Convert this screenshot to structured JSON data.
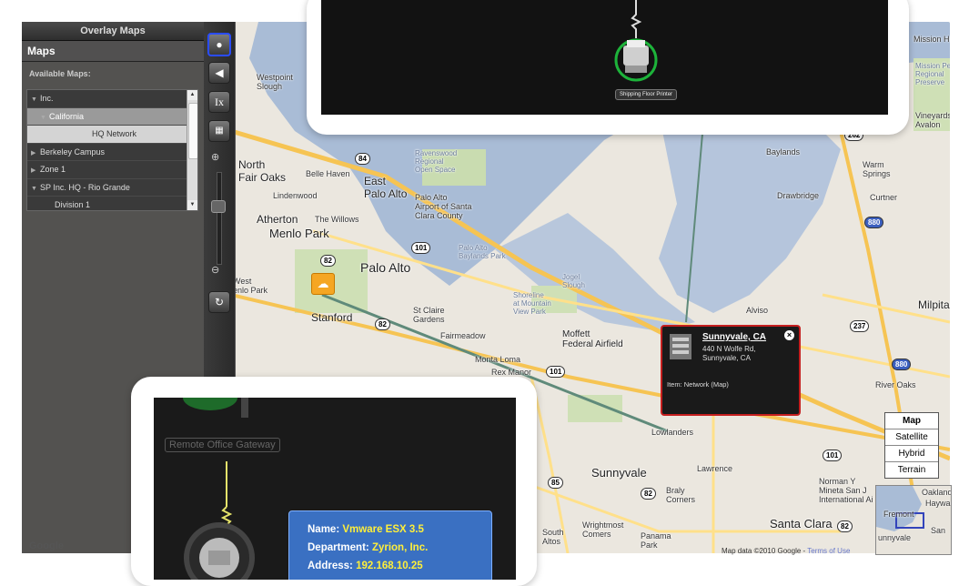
{
  "sidebar": {
    "title": "Overlay Maps",
    "heading": "Maps",
    "available_label": "Available Maps:",
    "tree": [
      {
        "label": "Inc.",
        "kind": "root"
      },
      {
        "label": "California",
        "kind": "sel"
      },
      {
        "label": "HQ Network",
        "kind": "hq"
      },
      {
        "label": "Berkeley Campus",
        "kind": "root"
      },
      {
        "label": "Zone 1",
        "kind": "root"
      },
      {
        "label": "SP Inc. HQ - Rio Grande",
        "kind": "root"
      },
      {
        "label": "Division 1",
        "kind": "child"
      }
    ]
  },
  "toolbar": {
    "buttons": [
      "pointer-icon",
      "back-icon",
      "ix-icon",
      "layout-icon",
      "zoom-in-icon",
      "zoom-out-icon",
      "refresh-icon"
    ]
  },
  "top_panel": {
    "printer_label": "Shipping Floor Printer"
  },
  "popup": {
    "title": "Sunnyvale, CA",
    "addr1": "440 N Wolfe Rd,",
    "addr2": "Sunnyvale, CA",
    "item": "Item: Network (Map)",
    "close": "×"
  },
  "bottom_panel": {
    "gateway_label": "Remote Office Gateway",
    "name_label": "Name:",
    "name_value": "Vmware ESX 3.5",
    "dept_label": "Department:",
    "dept_value": "Zyrion, Inc.",
    "addr_label": "Address:",
    "addr_value": "192.168.10.25"
  },
  "map_type": {
    "options": [
      "Map",
      "Satellite",
      "Hybrid",
      "Terrain"
    ],
    "selected": "Map"
  },
  "overview": {
    "labels": [
      "Oakland",
      "Haywa",
      "Fremont",
      "unnyvale",
      "San"
    ]
  },
  "map_footer": {
    "data": "Map data ©2010  Google -",
    "terms": "Terms of Use",
    "logo": "Google"
  },
  "map_labels": {
    "westpoint_slough": "Westpoint\nSlough",
    "north_fair_oaks": "North\nFair Oaks",
    "belle_haven": "Belle Haven",
    "east_palo_alto": "East\nPalo Alto",
    "lindenwood": "Lindenwood",
    "atherton": "Atherton",
    "the_willows": "The Willows",
    "menlo_park": "Menlo Park",
    "palo_alto": "Palo Alto",
    "west_menlo_park": "West\nenlo Park",
    "stanford": "Stanford",
    "ravenswood": "Ravenswood\nRegional\nOpen Space",
    "palo_alto_airport": "Palo Alto\nAirport of Santa\nClara County",
    "palo_alto_baylands": "Palo Alto\nBaylands Park",
    "st_claire": "St Claire\nGardens",
    "shoreline": "Shoreline\nat Mountain\nView Park",
    "jogel": "Jogel\nSlough",
    "moffett": "Moffett\nFederal Airfield",
    "fairmeadow": "Fairmeadow",
    "monta_loma": "Monta Loma",
    "rex_manor": "Rex Manor",
    "sunnyvale": "Sunnyvale",
    "lowlanders": "Lowlanders",
    "lawrence": "Lawrence",
    "santa_clara": "Santa Clara",
    "braly_corners": "Braly\nCorners",
    "wrightmost": "Wrightmost\nComers",
    "panama_park": "Panama\nPark",
    "milpitas": "Milpitas",
    "alviso": "Alviso",
    "baylands": "Baylands",
    "drawbridge": "Drawbridge",
    "warm_springs": "Warm\nSprings",
    "curtner": "Curtner",
    "river_oaks": "River Oaks",
    "mission_hills": "Mission Hill",
    "mission_peak": "Mission Pea\nRegional\nPreserve",
    "vineyards": "Vineyards\nAvalon",
    "norman_san": "Norman Y\nMineta San J\nInternational Ai",
    "south_altos": "South\nAltos",
    "fremont_hint": "Fremont",
    "menlo_sidebar": "Menlo Park"
  },
  "shields": [
    "84",
    "101",
    "82",
    "82",
    "101",
    "85",
    "82",
    "237",
    "880",
    "880",
    "262",
    "101",
    "82",
    "84"
  ]
}
